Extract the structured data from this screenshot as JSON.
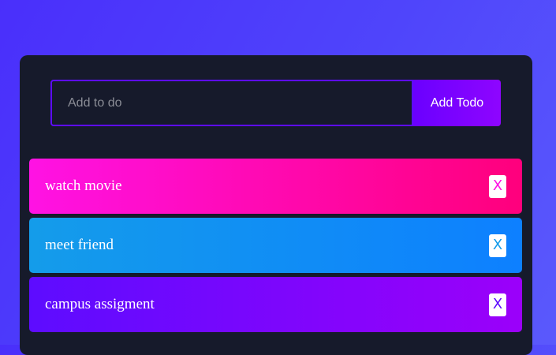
{
  "form": {
    "input_placeholder": "Add to do",
    "input_value": "",
    "add_label": "Add Todo"
  },
  "todos": [
    {
      "text": "watch movie",
      "delete_label": "X",
      "color": "#ff12e4"
    },
    {
      "text": "meet friend",
      "delete_label": "X",
      "color": "#149cea"
    },
    {
      "text": "campus assigment",
      "delete_label": "X",
      "color": "#5d0cff"
    }
  ],
  "colors": {
    "page_background": "#4f45fb",
    "app_background": "#161a2b",
    "accent": "#5d0cff"
  }
}
